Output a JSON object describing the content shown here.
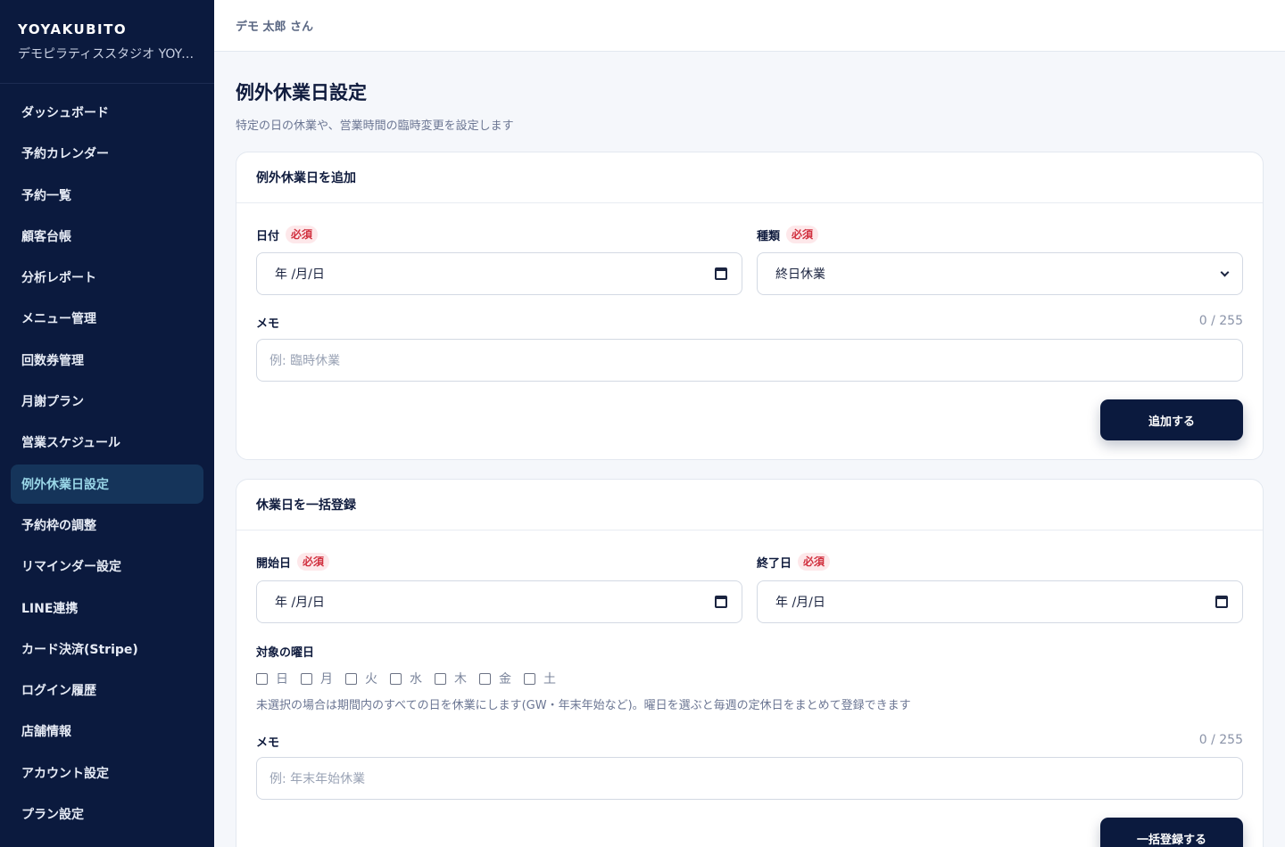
{
  "sidebar": {
    "brand": "YOYAKUBITO",
    "studio": "デモピラティススタジオ YOYAKUBITO",
    "items": [
      {
        "label": "ダッシュボード"
      },
      {
        "label": "予約カレンダー"
      },
      {
        "label": "予約一覧"
      },
      {
        "label": "顧客台帳"
      },
      {
        "label": "分析レポート"
      },
      {
        "label": "メニュー管理"
      },
      {
        "label": "回数券管理"
      },
      {
        "label": "月謝プラン"
      },
      {
        "label": "営業スケジュール"
      },
      {
        "label": "例外休業日設定",
        "active": true
      },
      {
        "label": "予約枠の調整"
      },
      {
        "label": "リマインダー設定"
      },
      {
        "label": "LINE連携"
      },
      {
        "label": "カード決済(Stripe)"
      },
      {
        "label": "ログイン履歴"
      },
      {
        "label": "店舗情報"
      },
      {
        "label": "アカウント設定"
      },
      {
        "label": "プラン設定"
      }
    ]
  },
  "topbar": {
    "user": "デモ 太郎 さん"
  },
  "page": {
    "title": "例外休業日設定",
    "subtitle": "特定の日の休業や、営業時間の臨時変更を設定します"
  },
  "add_card": {
    "title": "例外休業日を追加",
    "date_label": "日付",
    "type_label": "種類",
    "required": "必須",
    "date_value": "年 /月/日",
    "type_value": "終日休業",
    "memo_label": "メモ",
    "memo_counter": "0 / 255",
    "memo_placeholder": "例: 臨時休業",
    "submit": "追加する"
  },
  "bulk_card": {
    "title": "休業日を一括登録",
    "start_label": "開始日",
    "end_label": "終了日",
    "required": "必須",
    "start_value": "年 /月/日",
    "end_value": "年 /月/日",
    "weekday_label": "対象の曜日",
    "weekdays": [
      "日",
      "月",
      "火",
      "水",
      "木",
      "金",
      "土"
    ],
    "hint": "未選択の場合は期間内のすべての日を休業にします(GW・年末年始など)。曜日を選ぶと毎週の定休日をまとめて登録できます",
    "memo_label": "メモ",
    "memo_counter": "0 / 255",
    "memo_placeholder": "例: 年末年始休業",
    "submit": "一括登録する"
  }
}
